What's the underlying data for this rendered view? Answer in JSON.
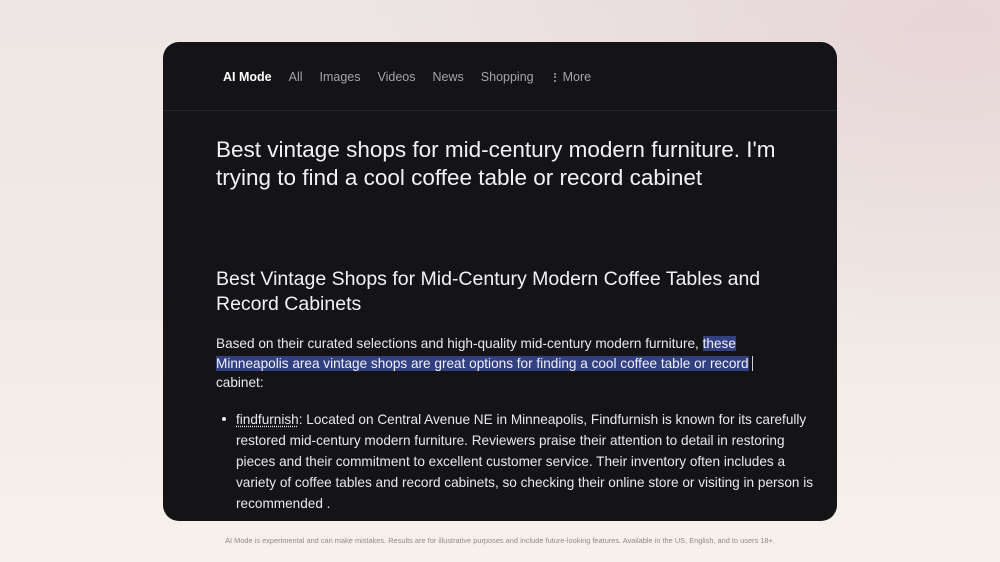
{
  "tabs": [
    {
      "label": "AI Mode",
      "active": true
    },
    {
      "label": "All",
      "active": false
    },
    {
      "label": "Images",
      "active": false
    },
    {
      "label": "Videos",
      "active": false
    },
    {
      "label": "News",
      "active": false
    },
    {
      "label": "Shopping",
      "active": false
    },
    {
      "label": "More",
      "active": false,
      "icon": "kebab-icon"
    }
  ],
  "query": "Best vintage shops for mid-century modern furniture. I'm trying to find a cool coffee table or record cabinet",
  "answer": {
    "heading": "Best Vintage Shops for Mid-Century Modern Coffee Tables and Record Cabinets",
    "intro_before": "Based on their curated selections and high-quality mid-century modern furniture, ",
    "intro_highlight": "these Minneapolis area vintage shops are great options for finding a cool coffee table or record",
    "intro_after": " cabinet:",
    "bullets": [
      {
        "shop": "findfurnish",
        "text": ": Located on Central Avenue NE in Minneapolis, Findfurnish is known for its carefully restored mid-century modern furniture. Reviewers praise their attention to detail in restoring pieces and their commitment to excellent customer service. Their inventory often includes a variety of coffee tables and record cabinets, so checking their online store or visiting in person is recommended ."
      }
    ]
  },
  "disclaimer": "AI Mode is experimental and can make mistakes. Results are for illustrative purposes and include future-looking features. Available in the US, English, and to users 18+.",
  "colors": {
    "card_background": "#141416",
    "selection_highlight": "#32407f",
    "text_primary": "#f1f2f4",
    "tab_inactive": "#a3a5aa"
  }
}
